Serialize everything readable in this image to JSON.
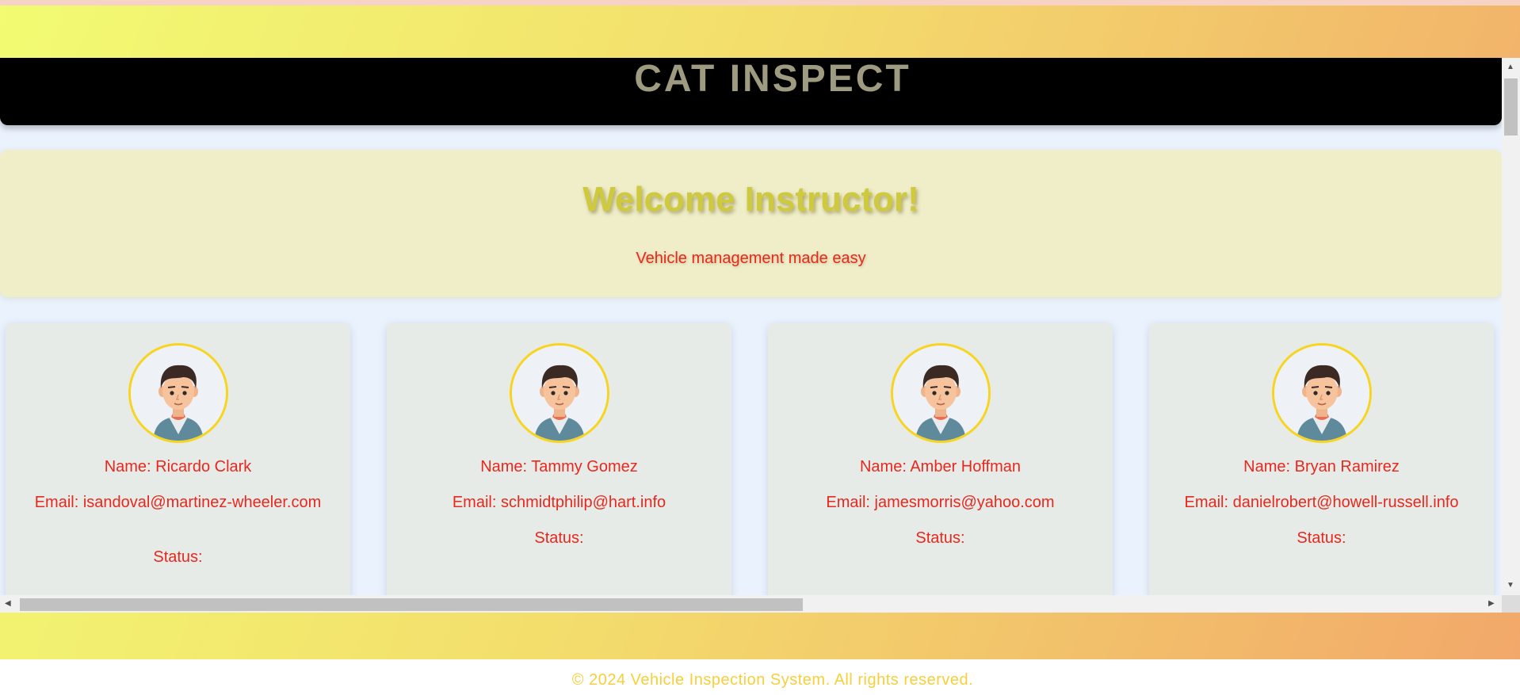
{
  "header": {
    "brand": "CAT INSPECT"
  },
  "hero": {
    "title": "Welcome Instructor!",
    "subtitle": "Vehicle management made easy"
  },
  "instructors": [
    {
      "name": "Name: Ricardo Clark",
      "email": "Email: isandoval@martinez-wheeler.com",
      "status": "Status:"
    },
    {
      "name": "Name: Tammy Gomez",
      "email": "Email: schmidtphilip@hart.info",
      "status": "Status:"
    },
    {
      "name": "Name: Amber Hoffman",
      "email": "Email: jamesmorris@yahoo.com",
      "status": "Status:"
    },
    {
      "name": "Name: Bryan Ramirez",
      "email": "Email: danielrobert@howell-russell.info",
      "status": "Status:"
    }
  ],
  "footer": {
    "text": "© 2024 Vehicle Inspection System. All rights reserved."
  },
  "icons": {
    "avatar": "user-avatar-icon",
    "scroll_up": "chevron-up-icon",
    "scroll_down": "chevron-down-icon",
    "scroll_left": "chevron-left-icon",
    "scroll_right": "chevron-right-icon"
  },
  "colors": {
    "header_bg": "#000000",
    "brand_text": "#9e9b80",
    "hero_title": "#cec93d",
    "accent_text": "#e8281e",
    "avatar_border": "#f7d51f",
    "footer_text": "#f7cf3a"
  }
}
